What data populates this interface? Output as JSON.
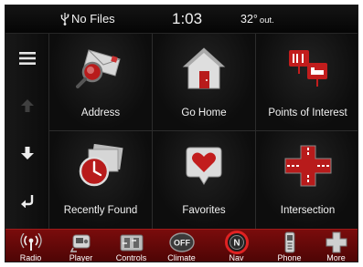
{
  "status": {
    "usb_text": "No Files",
    "time": "1:03",
    "temperature": "32°",
    "temperature_suffix": "out."
  },
  "sidebar": {
    "menu": "menu",
    "up": "up",
    "down": "down",
    "back": "back"
  },
  "tiles": [
    {
      "label": "Address",
      "icon": "address-envelope-icon"
    },
    {
      "label": "Go Home",
      "icon": "home-icon"
    },
    {
      "label": "Points of Interest",
      "icon": "points-of-interest-icon"
    },
    {
      "label": "Recently Found",
      "icon": "recently-found-clock-icon"
    },
    {
      "label": "Favorites",
      "icon": "favorites-heart-icon"
    },
    {
      "label": "Intersection",
      "icon": "intersection-icon"
    }
  ],
  "bottom_bar": [
    {
      "label": "Radio",
      "icon": "radio-icon"
    },
    {
      "label": "Player",
      "icon": "player-icon"
    },
    {
      "label": "Controls",
      "icon": "controls-icon"
    },
    {
      "label": "Climate",
      "icon": "climate-icon",
      "text": "OFF"
    },
    {
      "label": "Nav",
      "icon": "nav-compass-icon",
      "text": "N",
      "active": true
    },
    {
      "label": "Phone",
      "icon": "phone-icon"
    },
    {
      "label": "More",
      "icon": "more-icon"
    }
  ],
  "colors": {
    "accent": "#c81414",
    "bar": "#5c0808",
    "background": "#060606",
    "text": "#f2f2f2"
  }
}
